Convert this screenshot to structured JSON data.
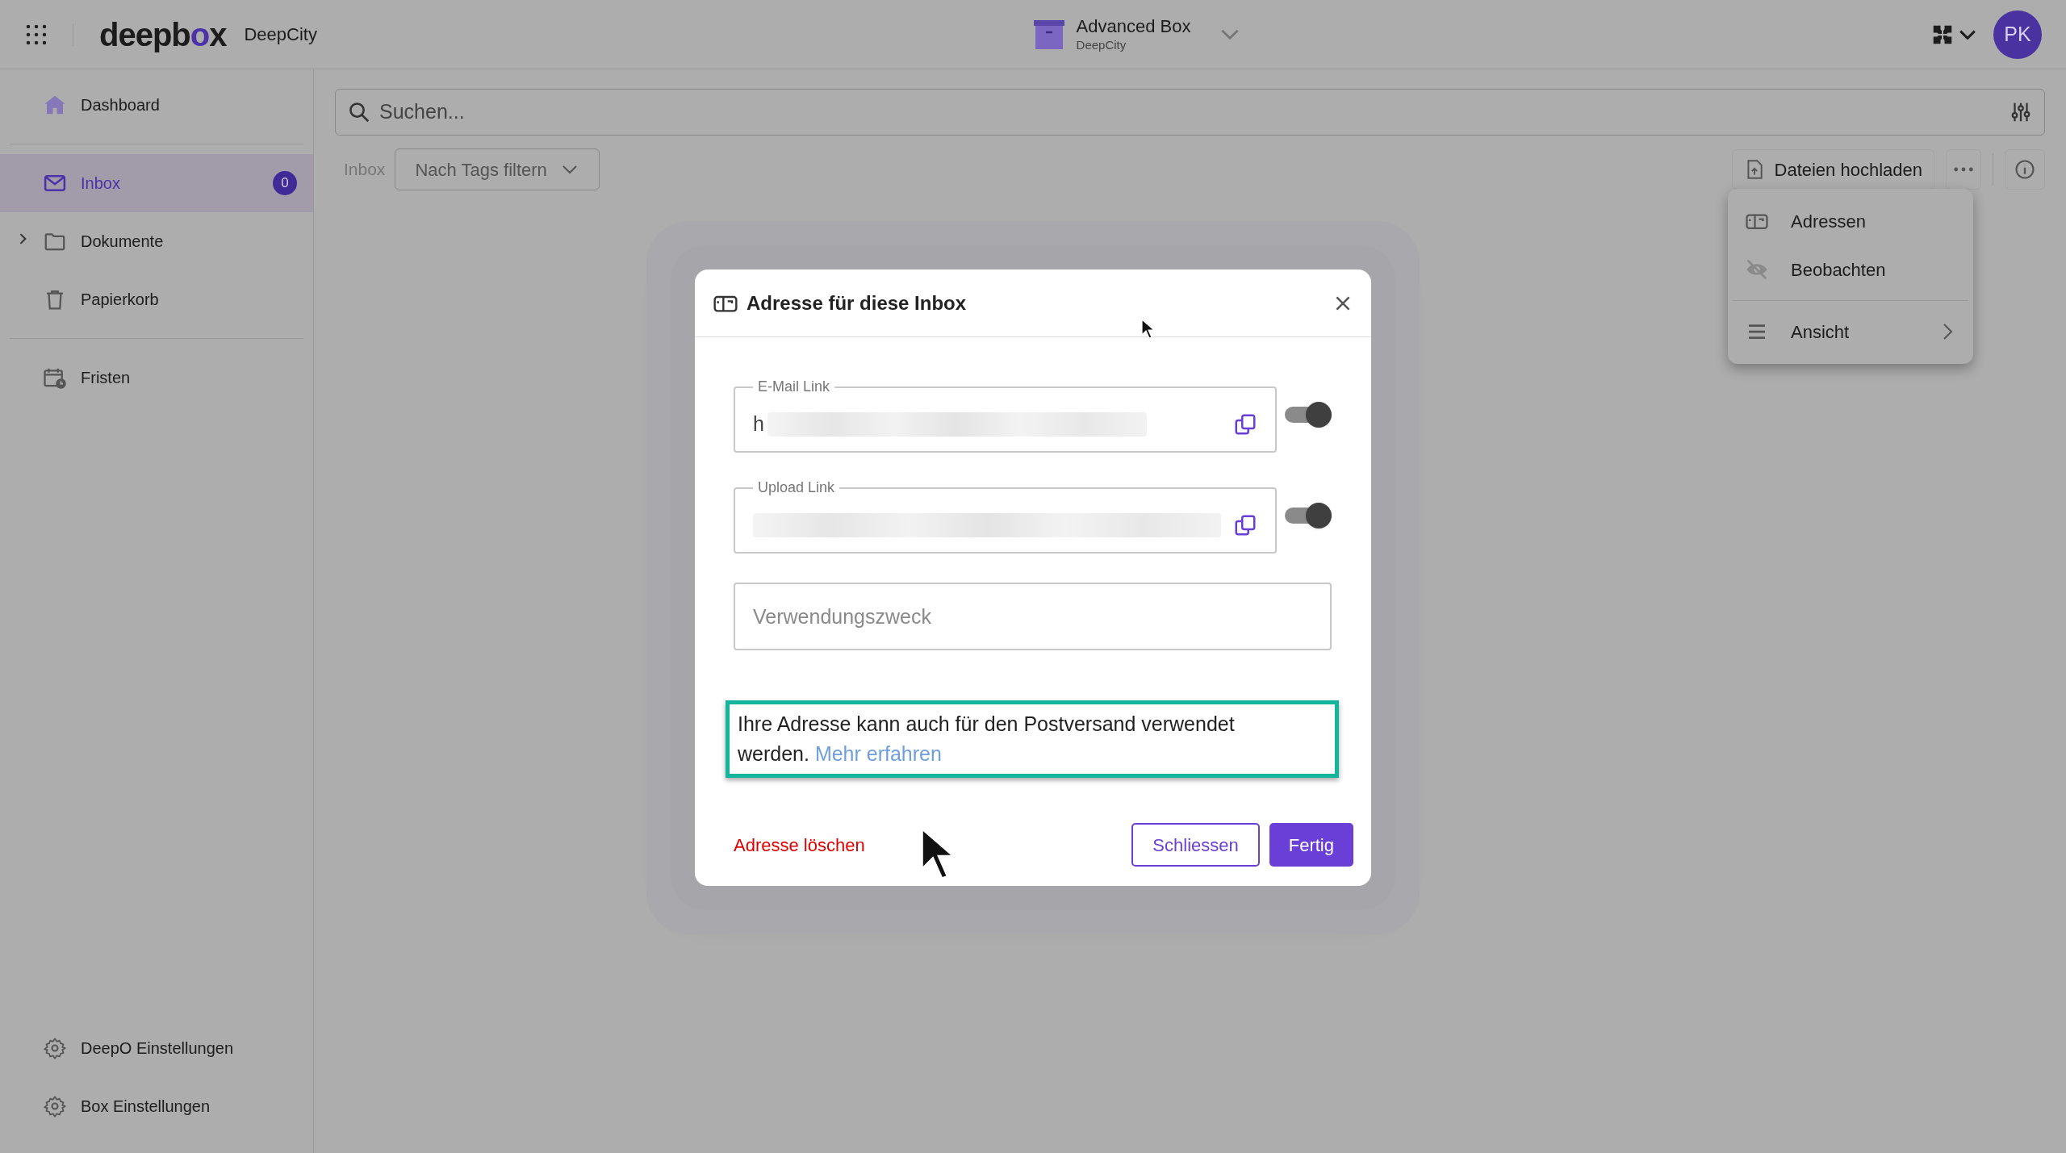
{
  "app": {
    "logo": [
      {
        "text": "deepb",
        "accent": false
      },
      {
        "text": "o",
        "accent": true
      },
      {
        "text": "x",
        "accent": false
      }
    ],
    "org": "DeepCity"
  },
  "box_selector": {
    "name": "Advanced Box",
    "org": "DeepCity"
  },
  "avatar": {
    "initials": "PK"
  },
  "sidebar": {
    "sections": [
      [
        {
          "label": "Dashboard",
          "selected": false
        }
      ],
      [
        {
          "label": "Inbox",
          "selected": true,
          "badge": "0"
        },
        {
          "label": "Dokumente",
          "selected": false,
          "expanded": false
        },
        {
          "label": "Papierkorb",
          "selected": false
        }
      ],
      [
        {
          "label": "Fristen",
          "selected": false
        }
      ]
    ],
    "footer_items": [
      {
        "label": "DeepO Einstellungen"
      },
      {
        "label": "Box Einstellungen"
      }
    ]
  },
  "search": {
    "placeholder": "Suchen..."
  },
  "toolbar": {
    "breadcrumb": "Inbox",
    "tag_filter": "Nach Tags filtern",
    "upload_button": "Dateien hochladen"
  },
  "menu": {
    "items": [
      {
        "label": "Adressen",
        "kind": "action"
      },
      {
        "label": "Beobachten",
        "kind": "action"
      },
      {
        "label": "Ansicht",
        "kind": "submenu"
      }
    ]
  },
  "dialog": {
    "title": "Adresse für diese Inbox",
    "links": [
      {
        "label": "E-Mail Link",
        "value": "h",
        "on": true
      },
      {
        "label": "Upload Link",
        "on": true
      }
    ],
    "purpose": {
      "placeholder": "Verwendungszweck"
    },
    "note": {
      "text": "Ihre Adresse kann auch für den Postversand verwendet werden.",
      "link": "Mehr erfahren",
      "highlighted": true
    },
    "delete_link": "Adresse löschen",
    "buttons": [
      {
        "label": "Schliessen",
        "kind": "secondary"
      },
      {
        "label": "Fertig",
        "kind": "primary"
      }
    ]
  }
}
